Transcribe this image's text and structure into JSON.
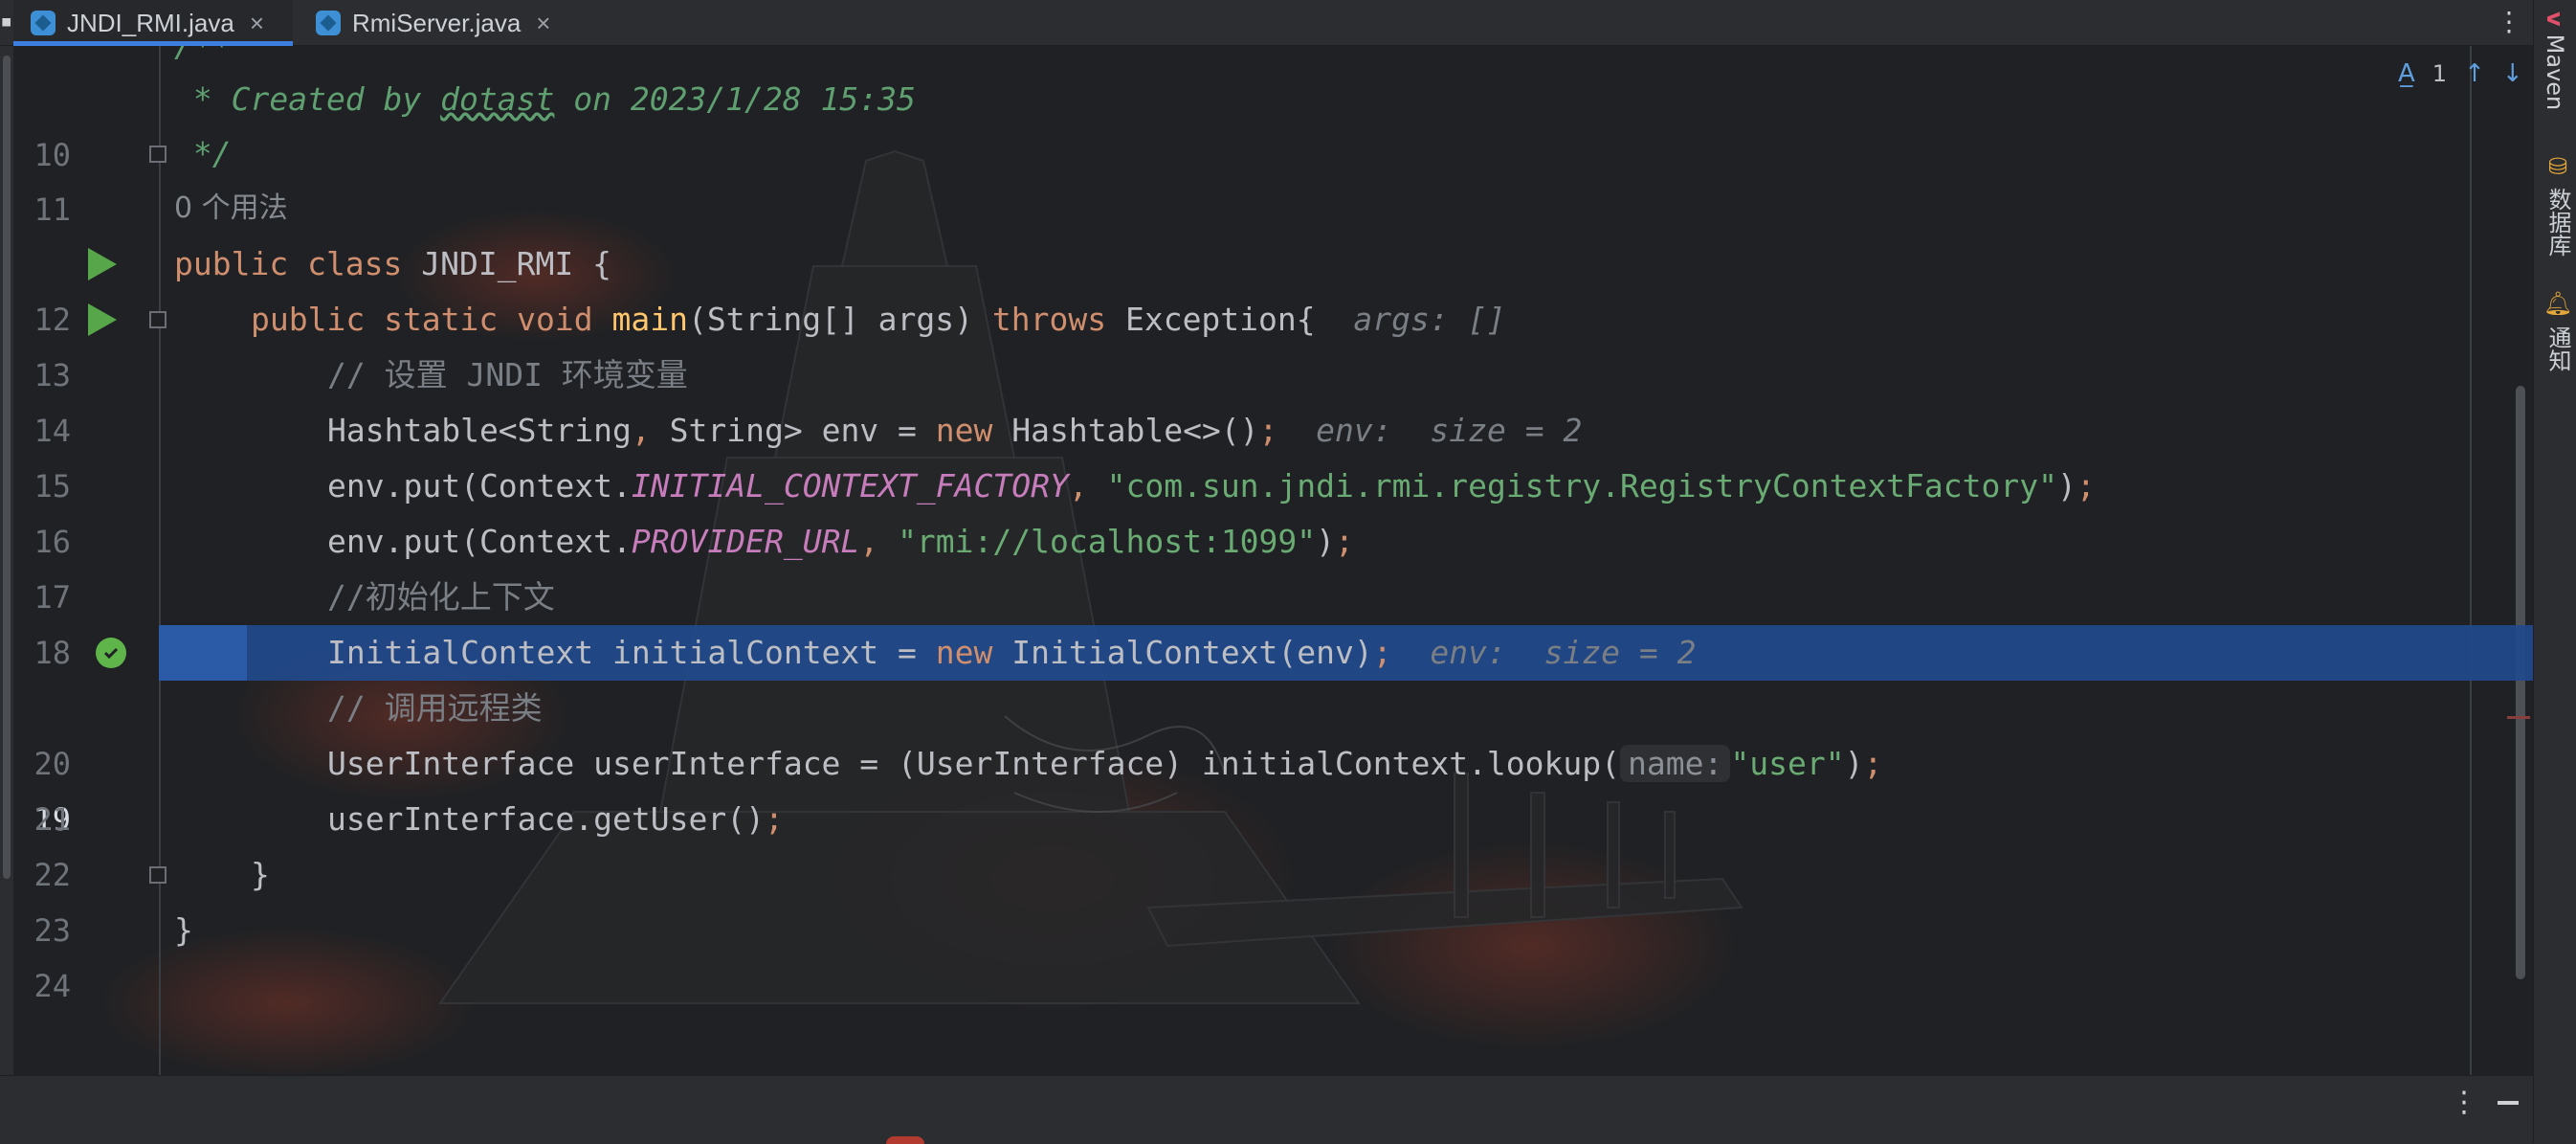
{
  "tabs": [
    {
      "name": "JNDI_RMI.java",
      "close": "×",
      "active": true
    },
    {
      "name": "RmiServer.java",
      "close": "×",
      "active": false
    }
  ],
  "inspection": {
    "count": "1"
  },
  "tool_windows": [
    {
      "label": "Maven",
      "icon": "m-icon"
    },
    {
      "label": "数据库",
      "icon": "database-icon"
    },
    {
      "label": "通知",
      "icon": "bell-icon"
    }
  ],
  "editor": {
    "top_partial": "/**",
    "lines": {
      "l10": {
        "num": "10",
        "a": " * Created by ",
        "author": "dotast",
        "b": " on 2023/1/28 15:35"
      },
      "l11": {
        "num": "11",
        "text": " */"
      },
      "usage": "0 个用法",
      "l12": {
        "num": "12",
        "kw": "public class ",
        "name": "JNDI_RMI",
        "rest": " {"
      },
      "l13": {
        "num": "13",
        "kw1": "public static void ",
        "fn": "main",
        "p1": "(String[] args) ",
        "kw2": "throws",
        "p2": " Exception{",
        "hint": "args: []"
      },
      "l14": {
        "num": "14",
        "comment": "// 设置 JNDI 环境变量"
      },
      "l15": {
        "num": "15",
        "p1": "Hashtable<String",
        "comma": ",",
        "p2": " String> env = ",
        "kw": "new",
        "p3": " Hashtable<>()",
        "semi": ";",
        "hint": "env:  size = 2"
      },
      "l16": {
        "num": "16",
        "p1": "env.put(Context.",
        "const": "INITIAL_CONTEXT_FACTORY",
        "comma": ",",
        "sp": " ",
        "str": "\"com.sun.jndi.rmi.registry.RegistryContextFactory\"",
        "close": ")",
        "semi": ";"
      },
      "l17": {
        "num": "17",
        "p1": "env.put(Context.",
        "const": "PROVIDER_URL",
        "comma": ",",
        "sp": " ",
        "str": "\"rmi://localhost:1099\"",
        "close": ")",
        "semi": ";"
      },
      "l18": {
        "num": "18",
        "comment": "//初始化上下文"
      },
      "l19": {
        "num": "19",
        "p1": "InitialContext initialContext = ",
        "kw": "new",
        "p2": " InitialContext(env)",
        "semi": ";",
        "hint": "env:  size = 2"
      },
      "l20": {
        "num": "20",
        "comment": "// 调用远程类"
      },
      "l21": {
        "num": "21",
        "p1": "UserInterface userInterface = (UserInterface) initialContext.lookup(",
        "pill": "name:",
        "str": "\"user\"",
        "close": ")",
        "semi": ";"
      },
      "l22": {
        "num": "22",
        "p1": "userInterface.getUser()",
        "semi": ";"
      },
      "l23": {
        "num": "23",
        "text": "}"
      },
      "l24": {
        "num": "24",
        "text": "}"
      }
    }
  },
  "colors": {
    "selection": "#214a8c",
    "keyword": "#cf8e6d",
    "string": "#6aab73",
    "constant": "#c77dbb",
    "function": "#ffc66d"
  }
}
